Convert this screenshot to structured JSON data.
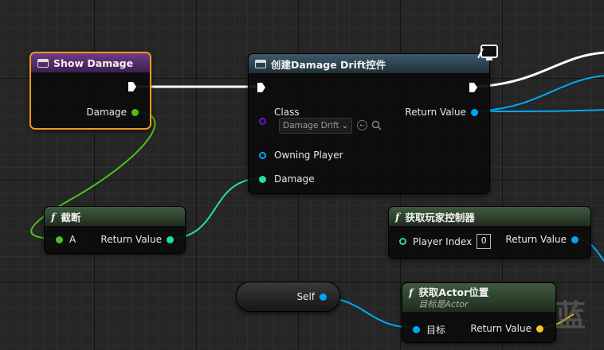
{
  "colors": {
    "exec": "#ffffff",
    "object": "#00a8f2",
    "integer": "#1ee0a8",
    "float": "#a4e632",
    "class": "#5a00a0",
    "vector": "#f7c322",
    "selection": "#f39c1a"
  },
  "nodes": {
    "show_damage": {
      "title": "Show Damage",
      "pin_damage": "Damage"
    },
    "create_widget": {
      "title": "创建Damage Drift控件",
      "pin_class": "Class",
      "class_value": "Damage Drift",
      "pin_return": "Return Value",
      "pin_owning_player": "Owning Player",
      "pin_damage": "Damage"
    },
    "truncate": {
      "title": "截断",
      "pin_a": "A",
      "pin_return": "Return Value"
    },
    "get_player_controller": {
      "title": "获取玩家控制器",
      "pin_player_index": "Player Index",
      "player_index_value": "0",
      "pin_return": "Return Value"
    },
    "self": {
      "label": "Self"
    },
    "get_actor_location": {
      "title": "获取Actor位置",
      "subtitle": "目标是Actor",
      "pin_target": "目标",
      "pin_return": "Return Value"
    }
  },
  "watermark": "蓝",
  "icons": {
    "function": "function-icon",
    "event": "event-icon",
    "widget": "widget-icon",
    "monitor": "monitor-icon"
  }
}
